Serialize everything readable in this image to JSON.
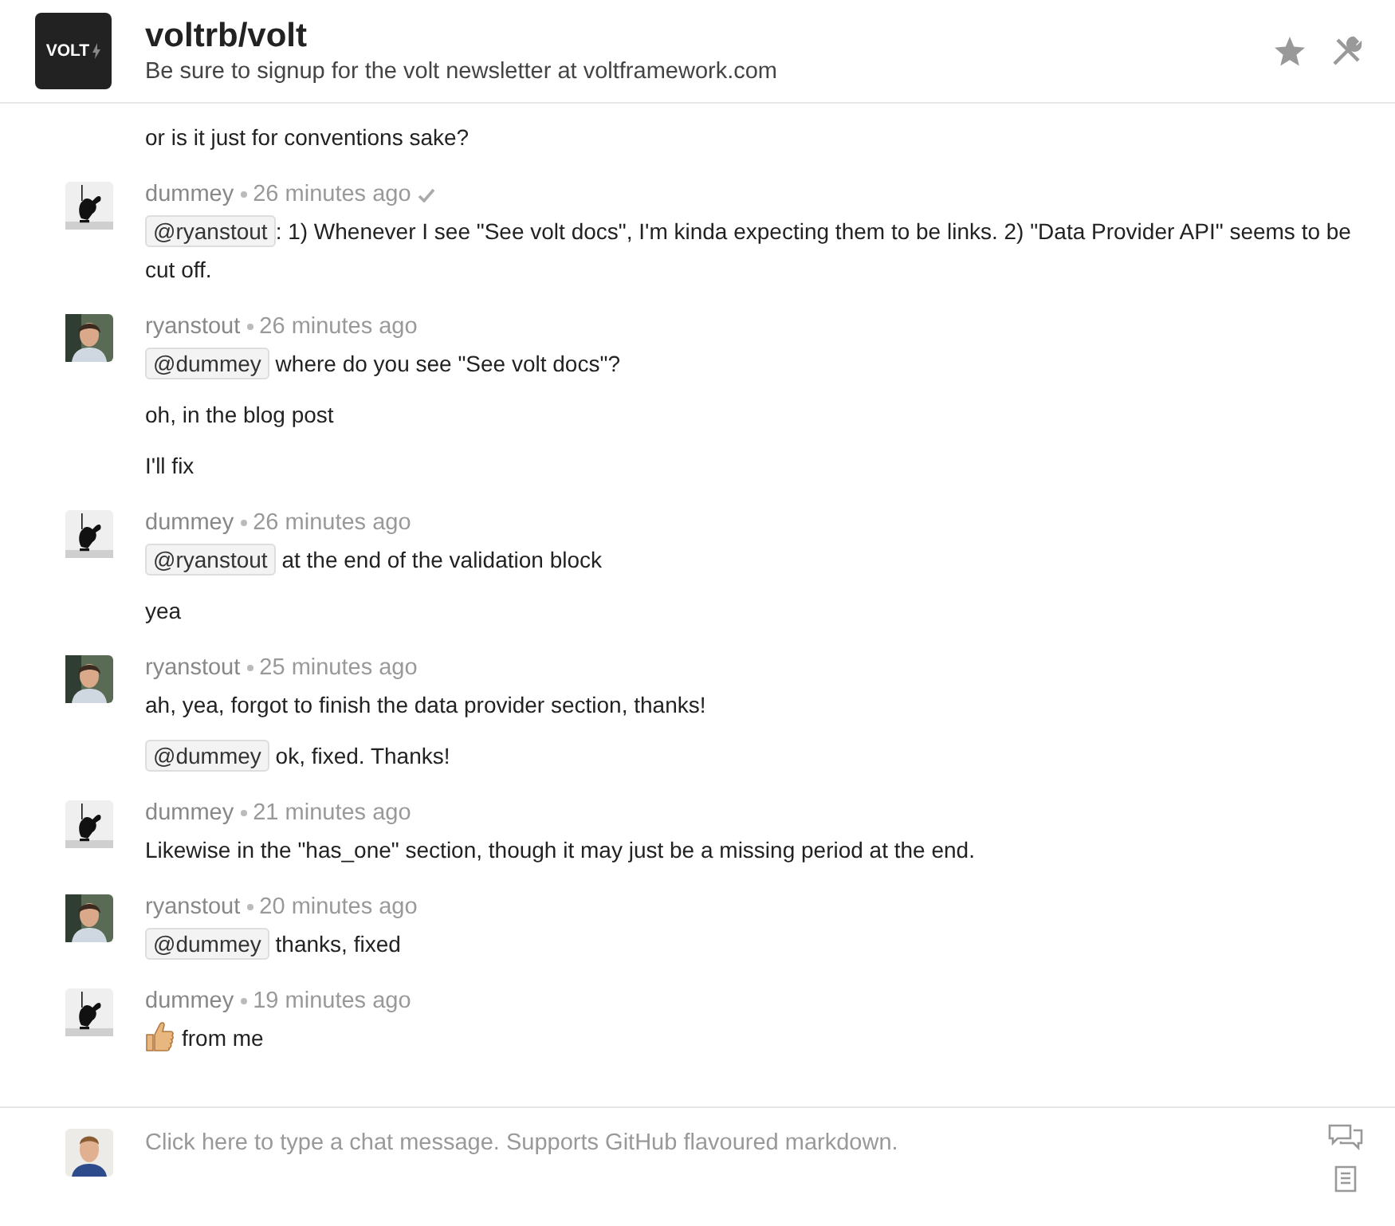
{
  "header": {
    "title": "voltrb/volt",
    "topic": "Be sure to signup for the volt newsletter at voltframework.com",
    "logo_text": "VOLT"
  },
  "messages": [
    {
      "lines": [
        {
          "text": "or is it just for conventions sake?"
        }
      ]
    },
    {
      "author": "dummey",
      "kind": "rabbit",
      "time": "26 minutes ago",
      "read": true,
      "lines": [
        {
          "mention": "@ryanstout",
          "text": ": 1) Whenever I see \"See volt docs\", I'm kinda expecting them to be links. 2) \"Data Provider API\" seems to be cut off."
        }
      ]
    },
    {
      "author": "ryanstout",
      "kind": "person",
      "time": "26 minutes ago",
      "read": false,
      "lines": [
        {
          "mention": "@dummey",
          "text": "where do you see \"See volt docs\"?"
        },
        {
          "text": "oh, in the blog post"
        },
        {
          "text": "I'll fix"
        }
      ]
    },
    {
      "author": "dummey",
      "kind": "rabbit",
      "time": "26 minutes ago",
      "read": false,
      "lines": [
        {
          "mention": "@ryanstout",
          "text": "at the end of the validation block"
        },
        {
          "text": "yea"
        }
      ]
    },
    {
      "author": "ryanstout",
      "kind": "person",
      "time": "25 minutes ago",
      "read": false,
      "lines": [
        {
          "text": "ah, yea, forgot to finish the data provider section, thanks!"
        },
        {
          "mention": "@dummey",
          "text": "ok, fixed. Thanks!"
        }
      ]
    },
    {
      "author": "dummey",
      "kind": "rabbit",
      "time": "21 minutes ago",
      "read": false,
      "lines": [
        {
          "text": "Likewise in the \"has_one\" section, though it may just be a missing period at the end."
        }
      ]
    },
    {
      "author": "ryanstout",
      "kind": "person",
      "time": "20 minutes ago",
      "read": false,
      "lines": [
        {
          "mention": "@dummey",
          "text": "thanks, fixed"
        }
      ]
    },
    {
      "author": "dummey",
      "kind": "rabbit",
      "time": "19 minutes ago",
      "read": false,
      "lines": [
        {
          "kind": "thumbs_up",
          "text": "from me"
        }
      ]
    }
  ],
  "composer": {
    "placeholder": "Click here to type a chat message. Supports GitHub flavoured markdown."
  }
}
